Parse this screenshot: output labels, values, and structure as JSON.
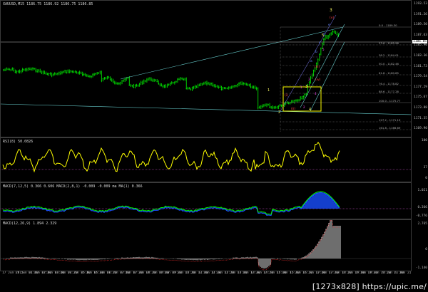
{
  "title_bar": "XAUUSD,M15  1186.75  1186.92  1186.75  1186.85",
  "price_axis": [
    "1193.53",
    "1191.26",
    "1189.50",
    "1187.63",
    "1185.90",
    "1183.36",
    "1181.73",
    "1179.54",
    "1177.29",
    "1175.67",
    "1173.88",
    "1171.35",
    "1169.90"
  ],
  "price_axis_highlight": "1186.85",
  "fib_levels": [
    "0.0 - 1189.30",
    "23.6 - 1185.96",
    "38.2 - 1184.01",
    "50.0 - 1182.46",
    "61.8 - 1180.85",
    "76.4 - 1178.82",
    "88.6 - 1177.28",
    "100.0 - 1175.77",
    "127.2 - 1171.19",
    "161.8 - 1166.69"
  ],
  "wave_labels": {
    "big_3": "3",
    "w1": "1",
    "w2": "2",
    "w3_small": "3",
    "w4": "4",
    "w5": "5",
    "red_i": "(i)",
    "red_ii": "(ii)",
    "red_iii": "(iii)",
    "red_iv": "(iv)",
    "red_v": "(v)",
    "blue_a": "a",
    "blue_b": "b",
    "blue_c": "c",
    "blue_d": "d",
    "blue_e": "e",
    "red_small": [
      "1",
      "2",
      "3",
      "4",
      "5"
    ]
  },
  "rsi": {
    "label": "RSI(8) 50.0826",
    "axis": [
      "100",
      "37",
      "0"
    ]
  },
  "macd1": {
    "label": "MACD(7,12,5) 0.366 0.606   MACD(2,8,1) -0.009 -0.009   ma MA(1) 0.366",
    "axis": [
      "1.021",
      "0.366",
      "-0.776"
    ]
  },
  "macd2": {
    "label": "MACD(12,26,9) 1.894 2.329",
    "axis": [
      "2.765",
      "0",
      "-1.140"
    ]
  },
  "time_axis": [
    "17 Jun 2015",
    "17 Jun 01:00",
    "17 Jun 02:00",
    "17 Jun 03:00",
    "17 Jun 04:20",
    "17 Jun 05:00",
    "17 Jun 05:40",
    "17 Jun 06:20",
    "17 Jun 07:00",
    "17 Jun 07:40",
    "17 Jun 08:20",
    "17 Jun 09:00",
    "17 Jun 09:40",
    "17 Jun 10:20",
    "17 Jun 11:00",
    "17 Jun 11:40",
    "17 Jun 12:20",
    "17 Jun 13:00",
    "17 Jun 13:40",
    "17 Jun 14:20",
    "17 Jun 15:00",
    "17 Jun 15:40",
    "17 Jun 16:20",
    "17 Jun 17:00",
    "17 Jun 17:40",
    "17 Jun 18:20",
    "17 Jun 19:00",
    "17 Jun 19:40",
    "17 Jun 20:20",
    "17 Jun 21:00",
    "17 Jun 21:40"
  ],
  "watermark": "[1273x828] https://upic.me/",
  "colors": {
    "bull": "#00e000",
    "bear": "#00e000",
    "rsi": "#ffff00",
    "macd_green": "#00ff00",
    "macd_blue": "#1a4fff",
    "fib": "#9a9a9a",
    "channel": "#66cccc",
    "box": "#ffff00",
    "hist": "#dcdcdc",
    "hist_red": "#ff3030"
  }
}
